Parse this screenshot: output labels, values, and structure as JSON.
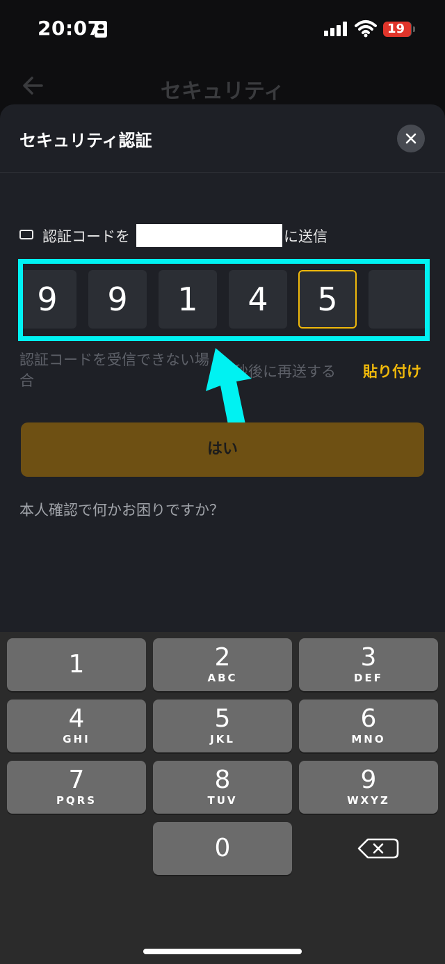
{
  "status_bar": {
    "time": "20:07",
    "battery": "19"
  },
  "background_nav": {
    "title": "セキュリティ"
  },
  "sheet": {
    "title": "セキュリティ認証",
    "sent_prefix": "認証コードを",
    "sent_suffix": "に送信",
    "otp_digits": [
      "9",
      "9",
      "1",
      "4",
      "5",
      ""
    ],
    "cant_receive": "認証コードを受信できない場合",
    "resend_countdown": "秒後に再送する",
    "paste": "貼り付け",
    "confirm": "はい",
    "help_link": "本人確認で何かお困りですか？"
  },
  "keyboard": {
    "keys": [
      {
        "num": "1",
        "letters": ""
      },
      {
        "num": "2",
        "letters": "ABC"
      },
      {
        "num": "3",
        "letters": "DEF"
      },
      {
        "num": "4",
        "letters": "GHI"
      },
      {
        "num": "5",
        "letters": "JKL"
      },
      {
        "num": "6",
        "letters": "MNO"
      },
      {
        "num": "7",
        "letters": "PQRS"
      },
      {
        "num": "8",
        "letters": "TUV"
      },
      {
        "num": "9",
        "letters": "WXYZ"
      },
      {
        "num": "0",
        "letters": ""
      }
    ]
  },
  "colors": {
    "accent": "#f0b90b",
    "annotation": "#00f2f2",
    "button": "#6e5013"
  }
}
